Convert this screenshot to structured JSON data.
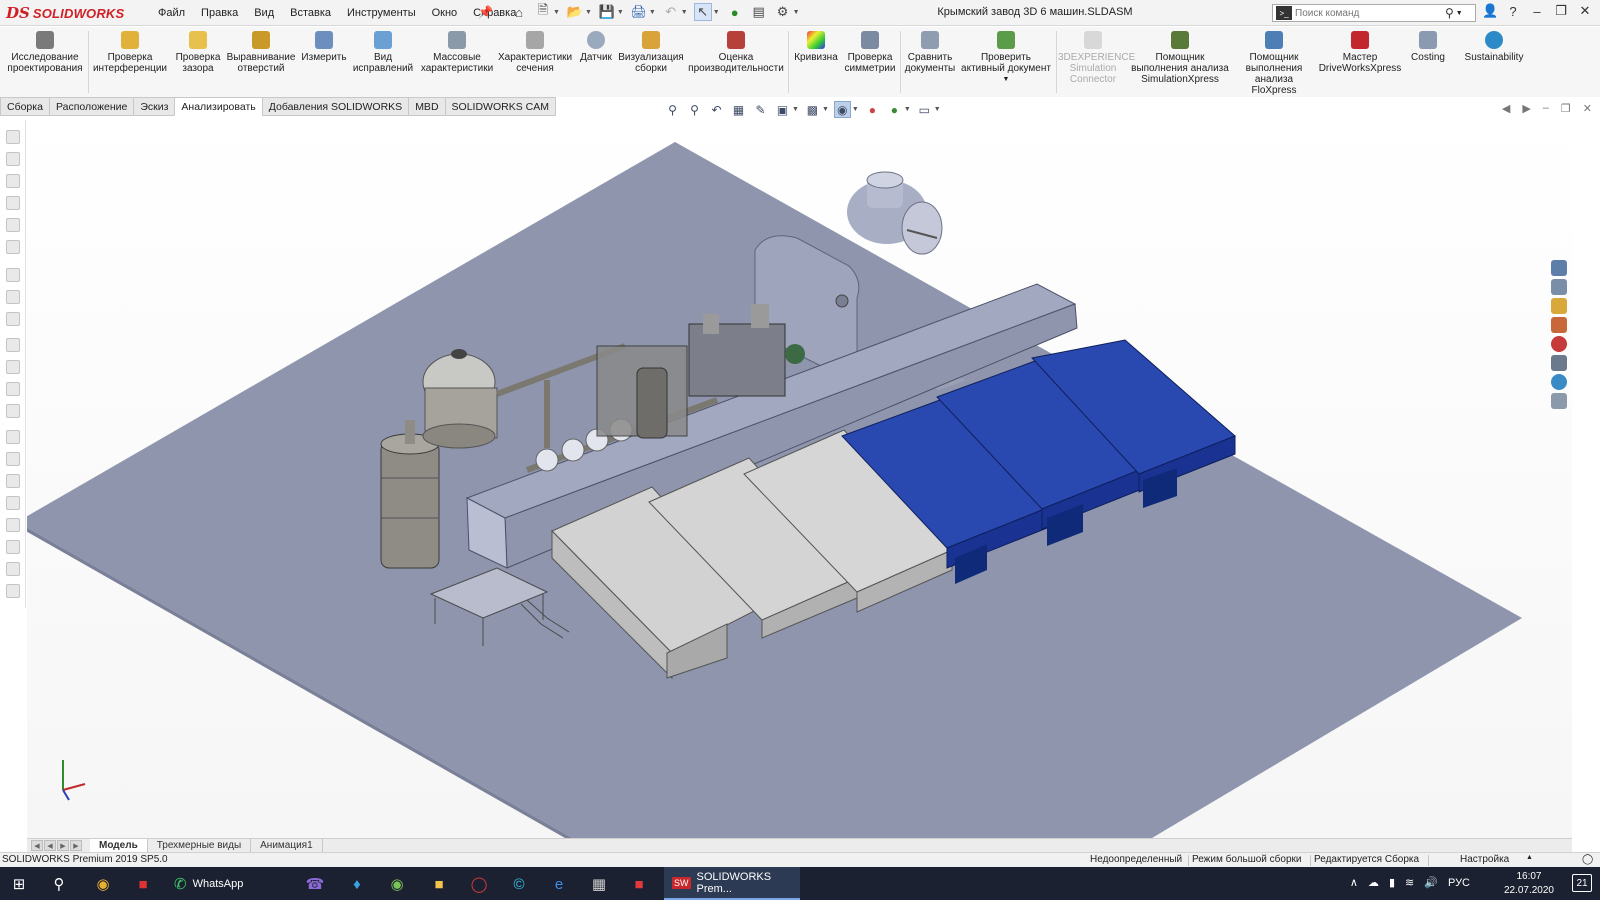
{
  "app": {
    "logo_ds": "DS",
    "logo_name": "SOLIDWORKS",
    "document_title": "Крымский завод 3D 6 машин.SLDASM"
  },
  "menu": [
    "Файл",
    "Правка",
    "Вид",
    "Вставка",
    "Инструменты",
    "Окно",
    "Справка"
  ],
  "search": {
    "placeholder": "Поиск команд"
  },
  "ribbon": {
    "design_study": "Исследование проектирования",
    "interference": "Проверка интерференции",
    "clearance": "Проверка зазора",
    "hole_alignment": "Выравнивание отверстий",
    "measure": "Измерить",
    "markup": "Вид исправлений",
    "mass_props": "Массовые характеристики",
    "section_props": "Характеристики сечения",
    "sensor": "Датчик",
    "assembly_vis": "Визуализация сборки",
    "performance": "Оценка производительности",
    "curvature": "Кривизна",
    "symmetry": "Проверка симметрии",
    "compare": "Сравнить документы",
    "check_active": "Проверить активный документ",
    "three_dx": "3DEXPERIENCE Simulation Connector",
    "simxpress": "Помощник выполнения анализа SimulationXpress",
    "floxpress": "Помощник выполнения анализа FloXpress",
    "driveworks": "Мастер DriveWorksXpress",
    "costing": "Costing",
    "sustainability": "Sustainability"
  },
  "tabs": [
    "Сборка",
    "Расположение",
    "Эскиз",
    "Анализировать",
    "Добавления SOLIDWORKS",
    "MBD",
    "SOLIDWORKS CAM"
  ],
  "active_tab": "Анализировать",
  "model_tabs": [
    "Модель",
    "Трехмерные виды",
    "Анимация1"
  ],
  "status": {
    "version": "SOLIDWORKS Premium 2019 SP5.0",
    "definition": "Недоопределенный",
    "large_asm": "Режим большой сборки",
    "editing": "Редактируется Сборка",
    "settings": "Настройка"
  },
  "taskbar": {
    "whatsapp": "WhatsApp",
    "solidworks": "SOLIDWORKS Prem...",
    "lang": "РУС",
    "time": "16:07",
    "date": "22.07.2020",
    "notifications": "21"
  },
  "colors": {
    "floor": "#8e95ad",
    "machine_blue": "#1f3a9a",
    "machine_gray": "#c9c9c9",
    "accent": "#d01f25"
  },
  "icons": {
    "home": "home-icon",
    "new": "new-document-icon",
    "open": "open-icon",
    "save": "save-icon",
    "print": "print-icon",
    "undo": "undo-icon",
    "select": "select-arrow-icon",
    "rebuild": "traffic-light-icon",
    "file_props": "file-properties-icon",
    "options": "gear-icon"
  }
}
